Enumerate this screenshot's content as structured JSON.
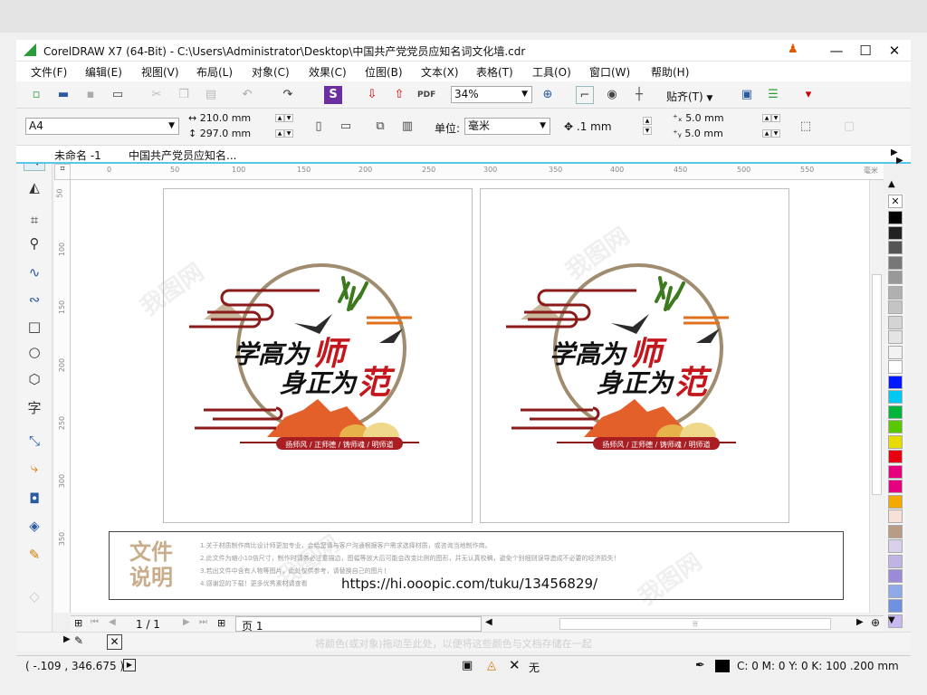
{
  "window": {
    "title": "CorelDRAW X7 (64-Bit) - C:\\Users\\Administrator\\Desktop\\中国共产党党员应知名词文化墙.cdr",
    "minimize": "—",
    "maximize": "☐",
    "close": "✕"
  },
  "menu": [
    "文件(F)",
    "编辑(E)",
    "视图(V)",
    "布局(L)",
    "对象(C)",
    "效果(C)",
    "位图(B)",
    "文本(X)",
    "表格(T)",
    "工具(O)",
    "窗口(W)",
    "帮助(H)"
  ],
  "toolbar": {
    "zoom": "34%",
    "snap_label": "贴齐(T)"
  },
  "propbar": {
    "paper": "A4",
    "width": "210.0 mm",
    "height": "297.0 mm",
    "unit_label": "单位:",
    "unit": "毫米",
    "nudge": ".1 mm",
    "dup_x": "5.0 mm",
    "dup_y": "5.0 mm"
  },
  "tabs": [
    "未命名 -1",
    "中国共产党员应知名..."
  ],
  "ruler": {
    "h_ticks": [
      "0",
      "50",
      "100",
      "150",
      "200",
      "250",
      "300",
      "350",
      "400",
      "450",
      "500",
      "550",
      "毫米"
    ],
    "v_ticks": [
      "50",
      "100",
      "150",
      "200",
      "250",
      "300",
      "350"
    ]
  },
  "design": {
    "line1_black": "学高为",
    "line1_red": "师",
    "line2_black": "身正为",
    "line2_red": "范",
    "banner": "扬师风 / 正师德 / 铸师魂 / 明师道"
  },
  "info": {
    "heading1": "文件",
    "heading2": "说明",
    "lines": [
      "1.关于材质制作商比设计师更加专业，会给您请与客户沟通根据客户需求选择材质，或咨询当地制作商。",
      "2.此文件为缩小10倍尺寸，制作时请务必注意描边，图幅等放大后可能会改变比例的图形，并无认真校稿，避免个别细则误导造成不必要的经济损失！",
      "3.若出文件中含有人物等图片，此处仅供参考，请替换自己的图片！",
      "4.感谢您的下载！更多优秀素材请查看"
    ],
    "url": "https://hi.ooopic.com/tuku/13456829/"
  },
  "pagenav": {
    "counter": "1 / 1",
    "page_tab": "页 1"
  },
  "docker_hint": "将颜色(或对象)拖动至此处，以便将这些颜色与文档存储在一起",
  "status": {
    "coords": "( -.109 , 346.675 )",
    "fill_none": "无",
    "outline": "C: 0 M: 0 Y: 0 K: 100  .200 mm"
  },
  "palette": [
    "#000000",
    "#222222",
    "#555555",
    "#777777",
    "#999999",
    "#b0b0b0",
    "#c4c4c4",
    "#d4d4d4",
    "#e4e4e4",
    "#f2f2f2",
    "#ffffff",
    "#0019ff",
    "#00c8f0",
    "#00b43c",
    "#5ac800",
    "#e6dc00",
    "#e60012",
    "#e6007e",
    "#e4007f",
    "#f2a900",
    "#f7e0d8",
    "#b89c86",
    "#d8cfe8",
    "#bfb4e4",
    "#9b8ad6",
    "#8fa8e8",
    "#7090e0",
    "#c8b8f0"
  ],
  "watermark": "我图网"
}
